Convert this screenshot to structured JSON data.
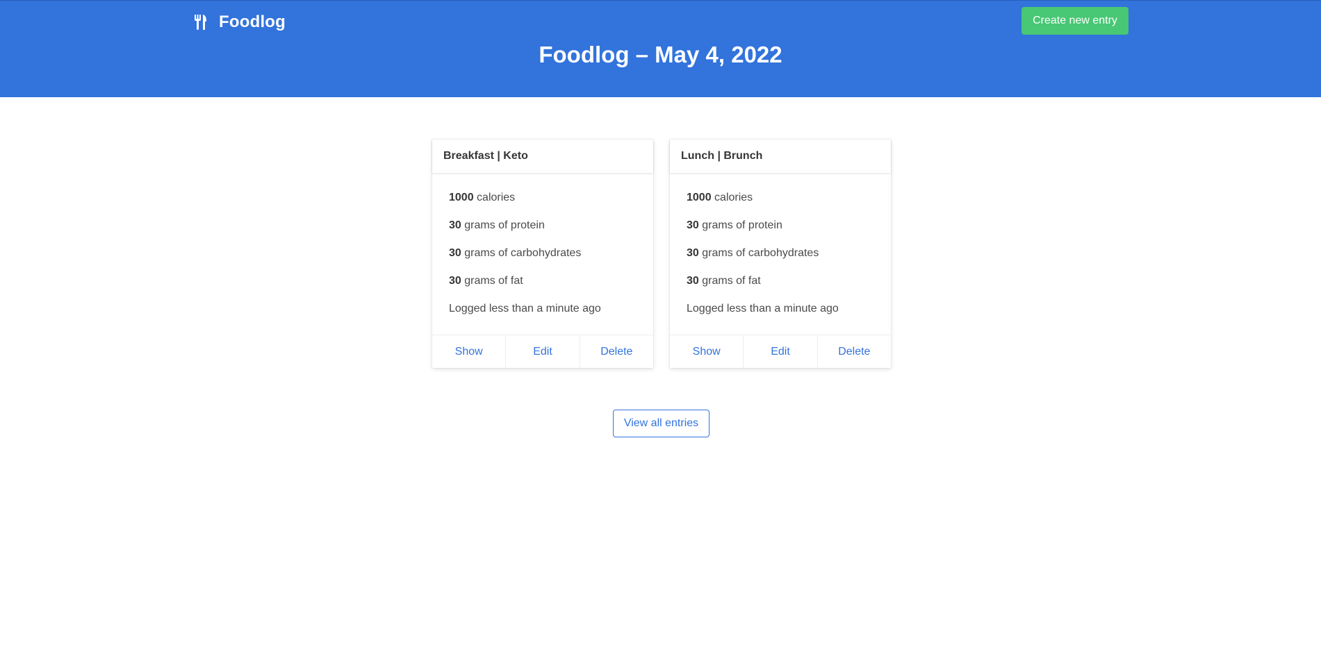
{
  "navbar": {
    "brand_name": "Foodlog",
    "brand_icon": "utensils-icon",
    "create_label": "Create new entry"
  },
  "hero": {
    "title": "Foodlog – May 4, 2022"
  },
  "entries": [
    {
      "title": "Breakfast | Keto",
      "calories": "1000",
      "calories_label": " calories",
      "protein": "30",
      "protein_label": " grams of protein",
      "carbs": "30",
      "carbs_label": " grams of carbohydrates",
      "fat": "30",
      "fat_label": " grams of fat",
      "logged": "Logged less than a minute ago",
      "actions": [
        "Show",
        "Edit",
        "Delete"
      ]
    },
    {
      "title": "Lunch | Brunch",
      "calories": "1000",
      "calories_label": " calories",
      "protein": "30",
      "protein_label": " grams of protein",
      "carbs": "30",
      "carbs_label": " grams of carbohydrates",
      "fat": "30",
      "fat_label": " grams of fat",
      "logged": "Logged less than a minute ago",
      "actions": [
        "Show",
        "Edit",
        "Delete"
      ]
    }
  ],
  "view_all_label": "View all entries",
  "colors": {
    "primary": "#3273dc",
    "success": "#48c774",
    "text": "#4a4a4a"
  }
}
